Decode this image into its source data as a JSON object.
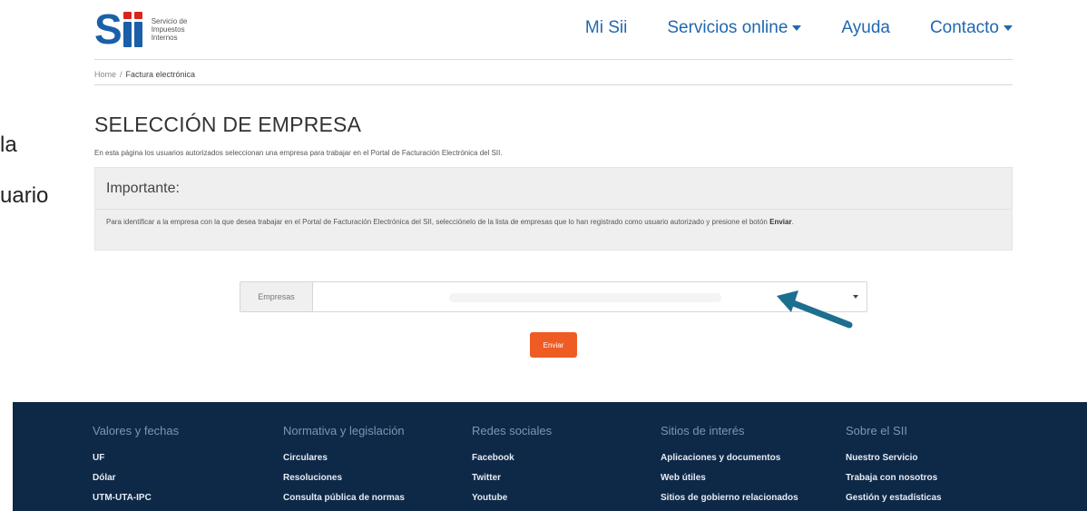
{
  "crop_left": {
    "line1": "la",
    "line2": "uario"
  },
  "logo": {
    "text": "Servicio de Impuestos Internos"
  },
  "nav": {
    "mi_sii": "Mi Sii",
    "servicios": "Servicios online",
    "ayuda": "Ayuda",
    "contacto": "Contacto"
  },
  "breadcrumb": {
    "home": "Home",
    "separator": "/",
    "current": "Factura electrónica"
  },
  "page": {
    "title": "SELECCIÓN DE EMPRESA",
    "description": "En esta página los usuarios autorizados seleccionan una empresa para trabajar en el Portal de Facturación Electrónica del SII."
  },
  "important": {
    "heading": "Importante:",
    "body": "Para identificar a la empresa con la que desea trabajar en el Portal de Facturación Electrónica del SII, selecciónelo de la lista de empresas que lo han registrado como usuario autorizado y presione el botón",
    "body_bold": "Enviar",
    "body_end": "."
  },
  "form": {
    "empresas_label": "Empresas",
    "send_button": "Enviar"
  },
  "colors": {
    "brand_blue": "#1a5fa8",
    "accent_red": "#d9261c",
    "button_orange": "#ef5b25",
    "footer_bg": "#0e2847",
    "arrow": "#1d6f8f"
  },
  "icons": {
    "arrow": "arrow-pointer-icon",
    "caret": "caret-down-icon"
  },
  "footer": {
    "columns": [
      {
        "heading": "Valores y fechas",
        "links": [
          "UF",
          "Dólar",
          "UTM-UTA-IPC"
        ]
      },
      {
        "heading": "Normativa y legislación",
        "links": [
          "Circulares",
          "Resoluciones",
          "Consulta pública de normas"
        ]
      },
      {
        "heading": "Redes sociales",
        "links": [
          "Facebook",
          "Twitter",
          "Youtube"
        ]
      },
      {
        "heading": "Sitios de interés",
        "links": [
          "Aplicaciones y documentos",
          "Web útiles",
          "Sitios de gobierno relacionados"
        ]
      },
      {
        "heading": "Sobre el SII",
        "links": [
          "Nuestro Servicio",
          "Trabaja con nosotros",
          "Gestión y estadísticas"
        ]
      }
    ]
  }
}
